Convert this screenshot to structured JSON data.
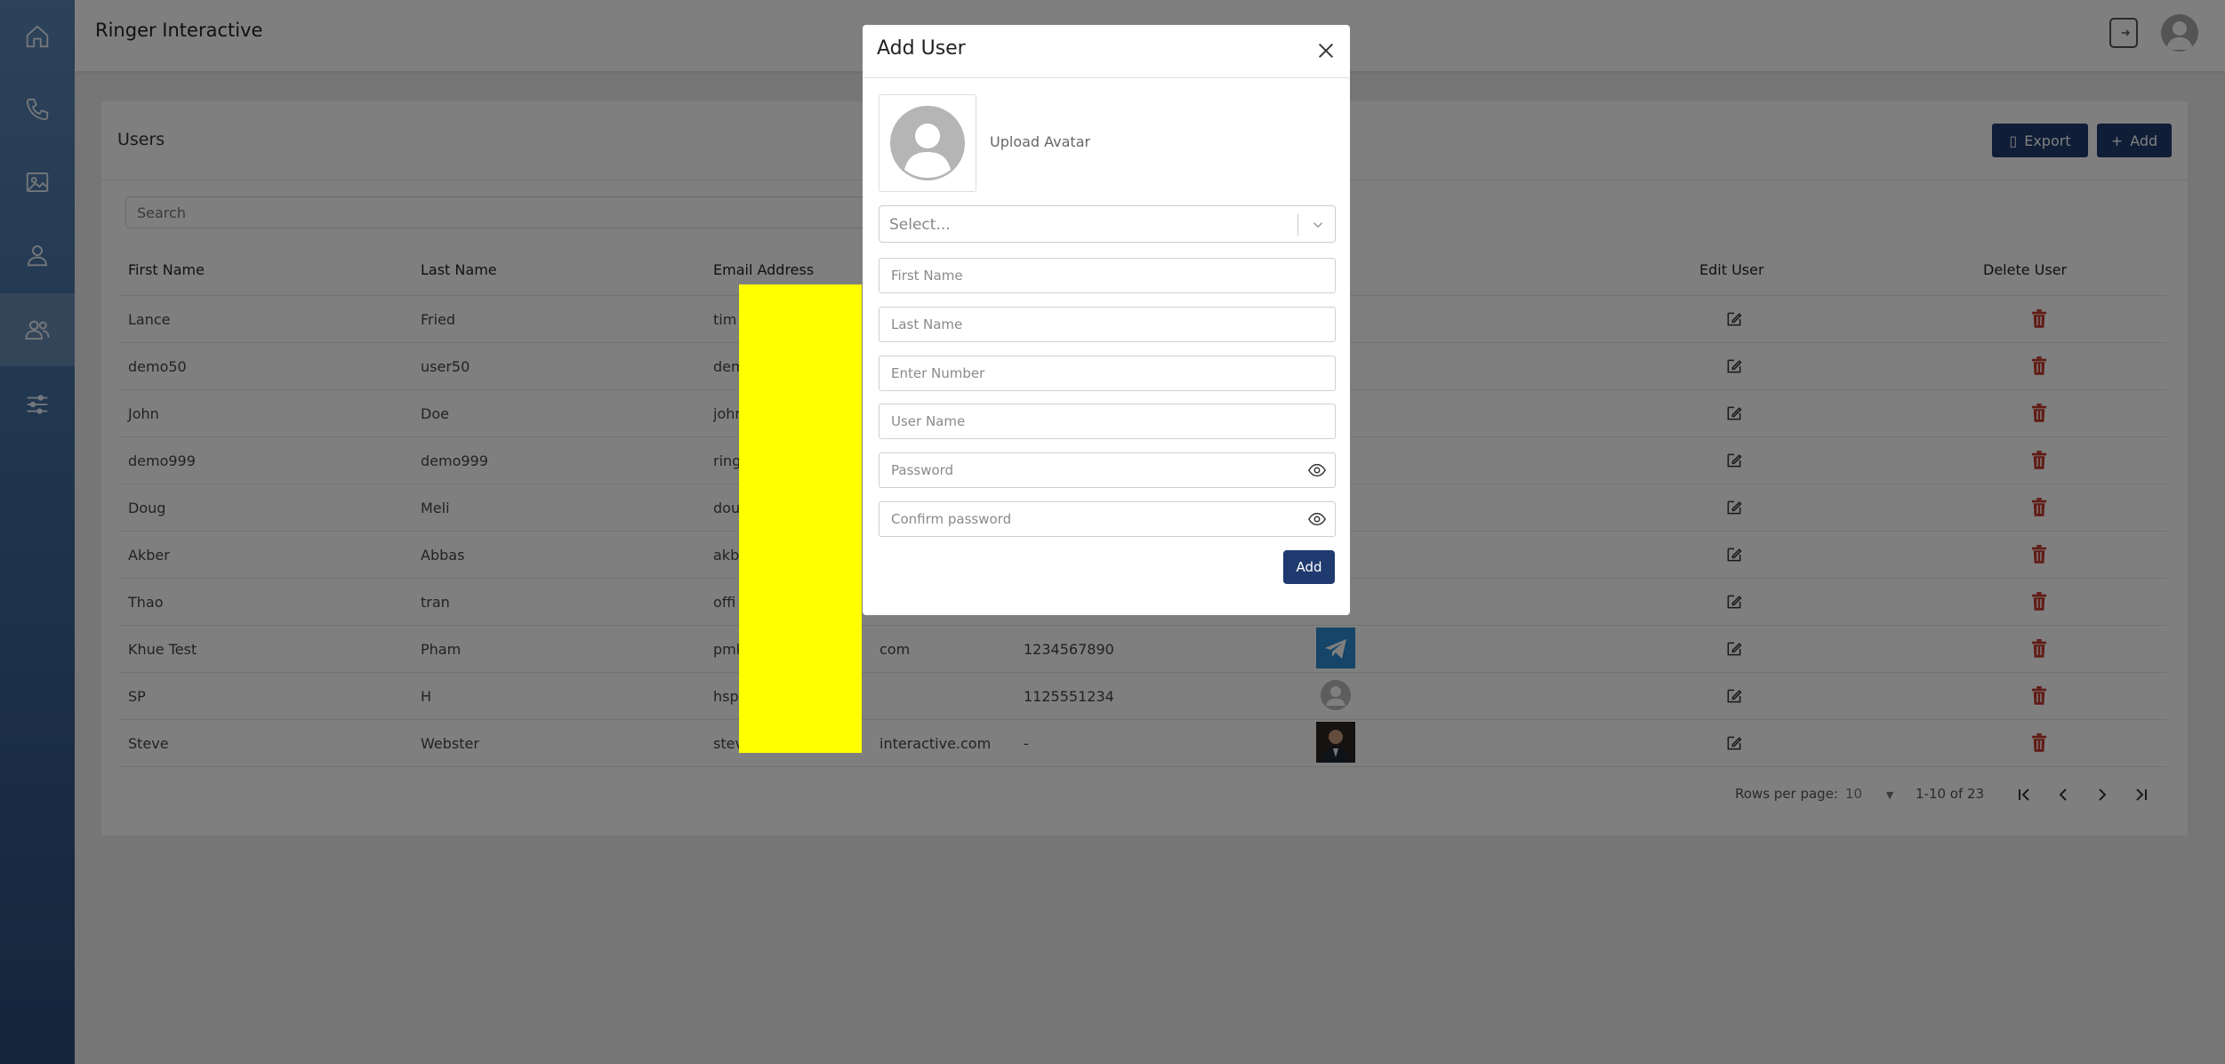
{
  "app": {
    "title": "Ringer Interactive"
  },
  "sidebar": {
    "items": [
      {
        "name": "home-icon"
      },
      {
        "name": "phone-icon"
      },
      {
        "name": "image-icon"
      },
      {
        "name": "user-icon"
      },
      {
        "name": "users-icon",
        "active": true
      },
      {
        "name": "sliders-icon"
      }
    ]
  },
  "header": {
    "logout_icon": "logout-icon",
    "avatar_icon": "avatar-icon"
  },
  "users": {
    "title": "Users",
    "export_label": "Export",
    "add_label": "Add",
    "search_placeholder": "Search",
    "columns": [
      "First Name",
      "Last Name",
      "Email Address",
      "Edit User",
      "Delete User"
    ],
    "rows": [
      {
        "first": "Lance",
        "last": "Fried",
        "email": "tim",
        "phone": "",
        "image": ""
      },
      {
        "first": "demo50",
        "last": "user50",
        "email": "dem",
        "phone": "",
        "image": ""
      },
      {
        "first": "John",
        "last": "Doe",
        "email": "john",
        "phone": "",
        "image": ""
      },
      {
        "first": "demo999",
        "last": "demo999",
        "email": "ring",
        "phone": "",
        "image": ""
      },
      {
        "first": "Doug",
        "last": "Meli",
        "email": "dou",
        "phone": "",
        "image": ""
      },
      {
        "first": "Akber",
        "last": "Abbas",
        "email": "akb",
        "phone": "",
        "image": ""
      },
      {
        "first": "Thao",
        "last": "tran",
        "email": "offi",
        "phone": "",
        "image": ""
      },
      {
        "first": "Khue Test",
        "last": "Pham",
        "email": "pmk",
        "email_tail": "com",
        "phone": "1234567890",
        "image": "telegram"
      },
      {
        "first": "SP",
        "last": "H",
        "email": "hsp",
        "phone": "1125551234",
        "image": "default-avatar"
      },
      {
        "first": "Steve",
        "last": "Webster",
        "email": "stev",
        "email_tail": "interactive.com",
        "phone": "-",
        "image": "photo"
      }
    ],
    "footer": {
      "rows_per_page_label": "Rows per page:",
      "rows_per_page_value": "10",
      "range": "1-10 of 23"
    }
  },
  "modal": {
    "title": "Add User",
    "upload_label": "Upload Avatar",
    "select_placeholder": "Select...",
    "first_name_placeholder": "First Name",
    "last_name_placeholder": "Last Name",
    "number_placeholder": "Enter Number",
    "username_placeholder": "User Name",
    "password_placeholder": "Password",
    "confirm_password_placeholder": "Confirm password",
    "add_label": "Add"
  },
  "colors": {
    "primary": "#1f3a6e",
    "delete": "#c0392b",
    "redaction": "#ffff00"
  }
}
